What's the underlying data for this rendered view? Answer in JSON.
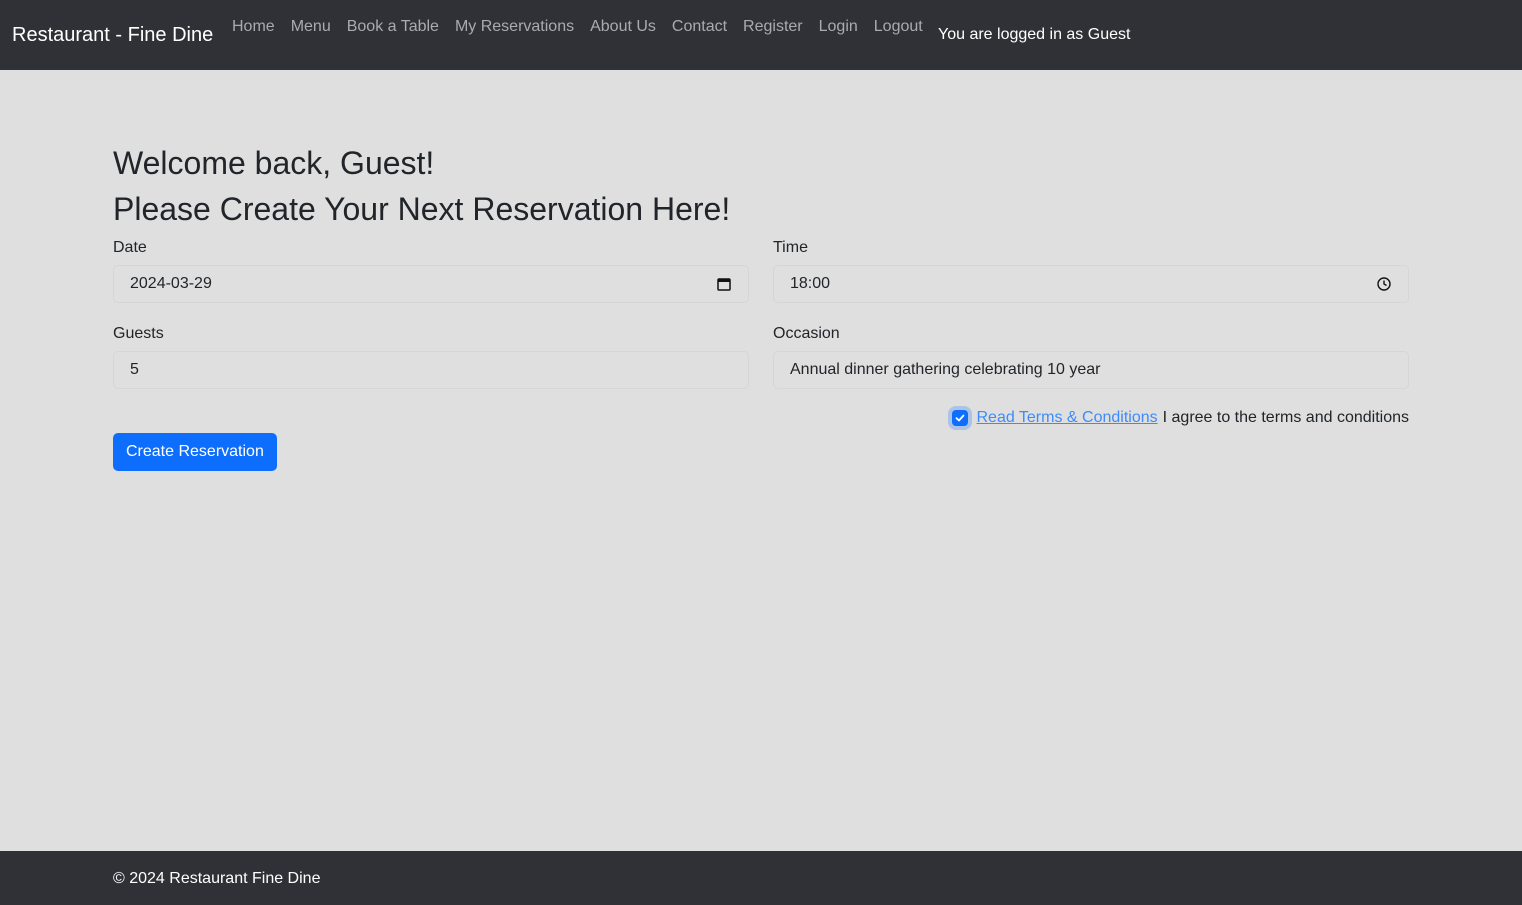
{
  "navbar": {
    "brand": "Restaurant - Fine Dine",
    "links": [
      "Home",
      "Menu",
      "Book a Table",
      "My Reservations",
      "About Us",
      "Contact",
      "Register",
      "Login",
      "Logout"
    ],
    "status": "You are logged in as Guest"
  },
  "main": {
    "welcome": "Welcome back, Guest!",
    "subtitle": "Please Create Your Next Reservation Here!",
    "date_label": "Date",
    "date_value": "2024-03-29",
    "time_label": "Time",
    "time_value": "18:00",
    "guests_label": "Guests",
    "guests_value": "5",
    "occasion_label": "Occasion",
    "occasion_value": "Annual dinner gathering celebrating 10 year",
    "terms_link": "Read Terms & Conditions",
    "terms_text": "I agree to the terms and conditions",
    "terms_checked": true,
    "submit_label": "Create Reservation"
  },
  "footer": {
    "text": "© 2024 Restaurant Fine Dine"
  },
  "colors": {
    "navbar_bg": "#2f3136",
    "page_bg": "#dfdfdf",
    "primary": "#0d6efd",
    "link": "#3d8bfd"
  }
}
